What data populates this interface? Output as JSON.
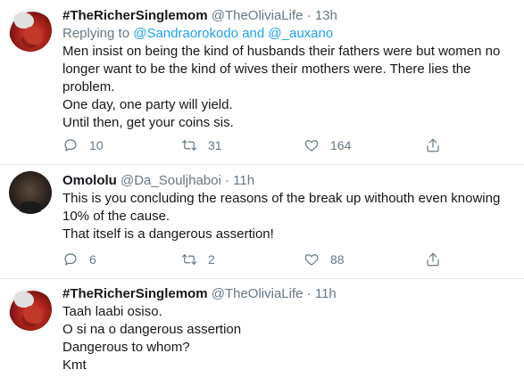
{
  "tweets": [
    {
      "display_name": "#TheRicherSinglemom",
      "handle": "@TheOliviaLife",
      "separator": "·",
      "time": "13h",
      "reply_prefix": "Replying to",
      "reply_mention_1": "@Sandraorokodo",
      "reply_and": "and",
      "reply_mention_2": "@_auxano",
      "lines": [
        "Men insist on being the kind of husbands their fathers were but women no",
        "longer want to be the kind of wives their mothers were. There lies the",
        "problem.",
        "One day, one party will yield.",
        "Until then, get your coins sis."
      ],
      "reply_count": "10",
      "retweet_count": "31",
      "like_count": "164"
    },
    {
      "display_name": "Omololu",
      "handle": "@Da_Souljhaboi",
      "separator": "·",
      "time": "11h",
      "lines": [
        "This is you concluding the reasons of the break up withouth even knowing",
        "10% of the cause.",
        "That itself is a dangerous assertion!"
      ],
      "reply_count": "6",
      "retweet_count": "2",
      "like_count": "88"
    },
    {
      "display_name": "#TheRicherSinglemom",
      "handle": "@TheOliviaLife",
      "separator": "·",
      "time": "11h",
      "lines": [
        "Taah laabi osiso.",
        "O si na o dangerous assertion",
        "Dangerous to whom?",
        "Kmt"
      ]
    }
  ],
  "icons": {
    "reply": "reply-icon",
    "retweet": "retweet-icon",
    "like": "heart-icon",
    "share": "share-icon"
  },
  "colors": {
    "link": "#1da1f2",
    "secondary_text": "#657786",
    "divider": "#e6ecf0"
  }
}
